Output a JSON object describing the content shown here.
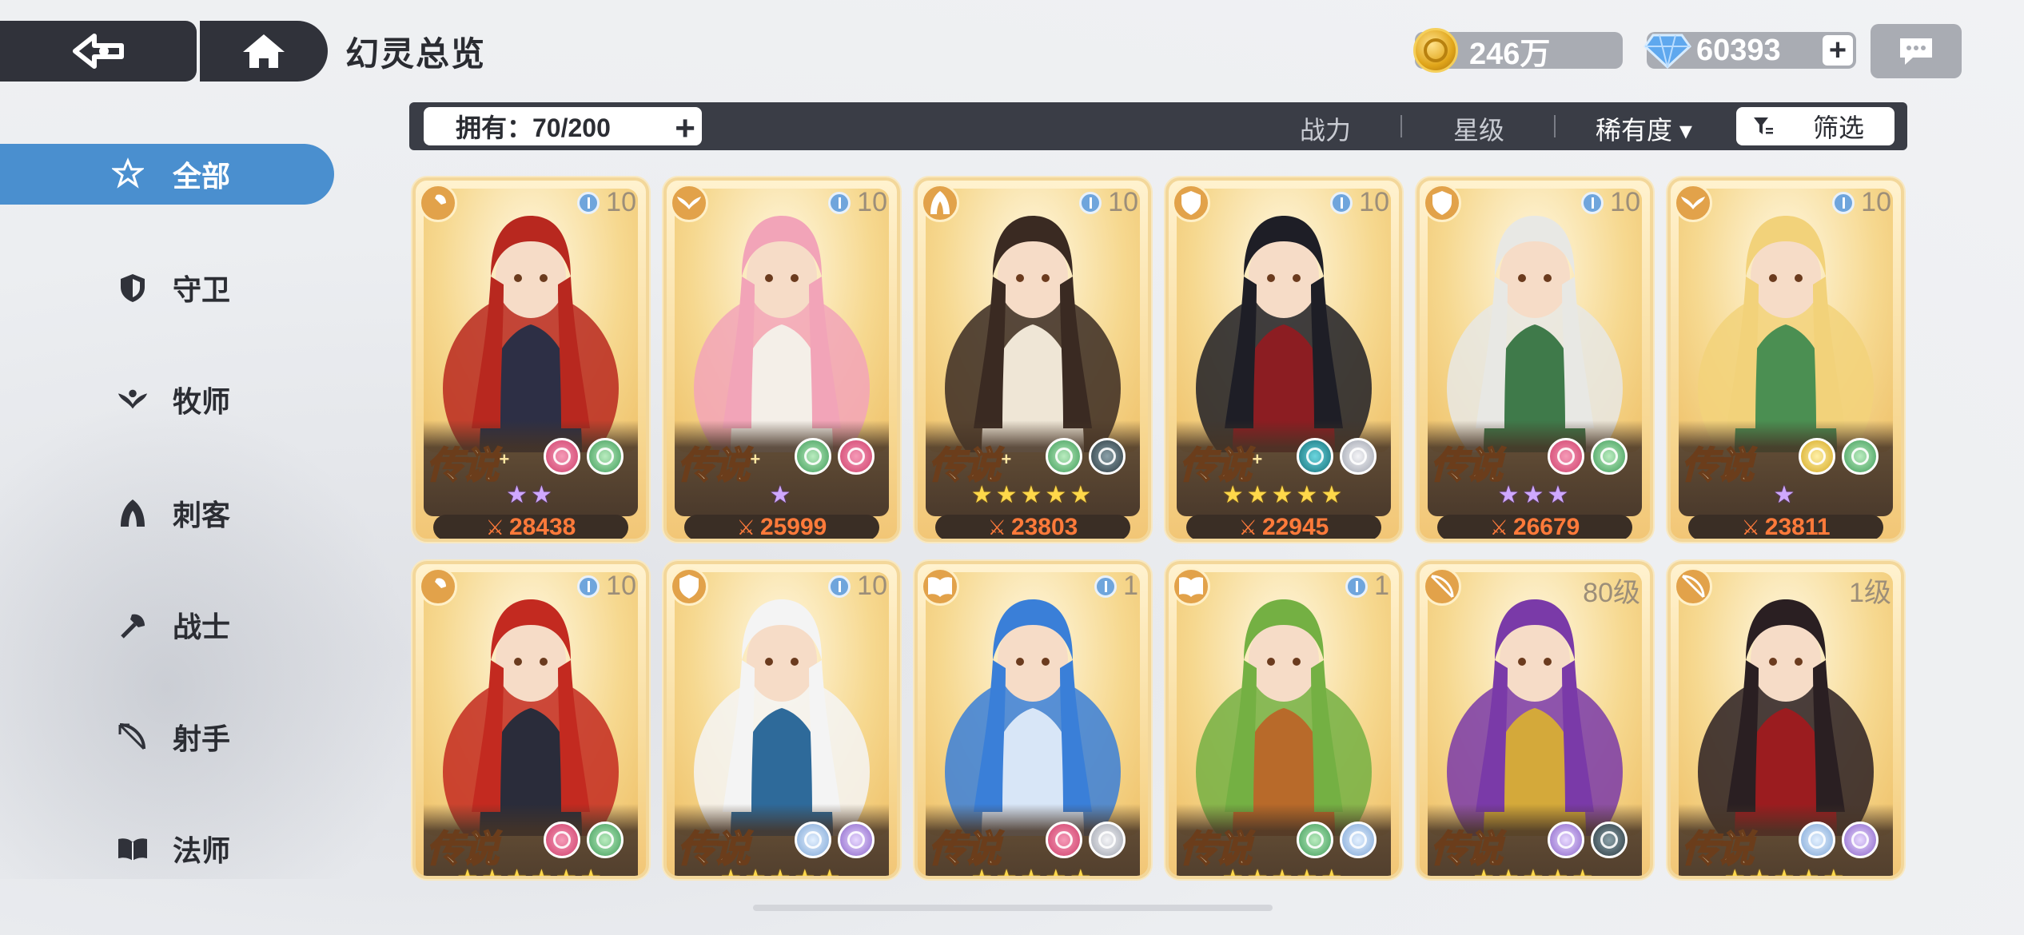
{
  "header": {
    "title": "幻灵总览",
    "gold": "246万",
    "gems": "60393"
  },
  "filter": {
    "owned": "拥有：70/200",
    "sort_power": "战力",
    "sort_star": "星级",
    "sort_rarity": "稀有度 ▾",
    "screen": "筛选"
  },
  "sidebar": {
    "items": [
      {
        "label": "全部"
      },
      {
        "label": "守卫"
      },
      {
        "label": "牧师"
      },
      {
        "label": "刺客"
      },
      {
        "label": "战士"
      },
      {
        "label": "射手"
      },
      {
        "label": "法师"
      }
    ]
  },
  "cards": [
    {
      "level": "10",
      "rarity": "传说",
      "plus": "+",
      "stars": "★★",
      "star_color": "purple",
      "power": "28438"
    },
    {
      "level": "10",
      "rarity": "传说",
      "plus": "+",
      "stars": "★",
      "star_color": "purple",
      "power": "25999"
    },
    {
      "level": "10",
      "rarity": "传说",
      "plus": "+",
      "stars": "★★★★★",
      "star_color": "gold",
      "power": "23803"
    },
    {
      "level": "10",
      "rarity": "传说",
      "plus": "+",
      "stars": "★★★★★",
      "star_color": "gold",
      "power": "22945"
    },
    {
      "level": "10",
      "rarity": "传说",
      "plus": "",
      "stars": "★★★",
      "star_color": "purple",
      "power": "26679"
    },
    {
      "level": "10",
      "rarity": "传说",
      "plus": "",
      "stars": "★",
      "star_color": "purple",
      "power": "23811"
    },
    {
      "level": "10",
      "rarity": "传说",
      "plus": "",
      "stars": "★★★★★★",
      "star_color": "gold",
      "power": ""
    },
    {
      "level": "10",
      "rarity": "传说",
      "plus": "",
      "stars": "★★★★★",
      "star_color": "gold",
      "power": ""
    },
    {
      "level": "1",
      "rarity": "传说",
      "plus": "",
      "stars": "★★★★★",
      "star_color": "gold",
      "power": ""
    },
    {
      "level": "1",
      "rarity": "传说",
      "plus": "",
      "stars": "★★★★★",
      "star_color": "gold",
      "power": ""
    },
    {
      "level": "80级",
      "rarity": "传说",
      "plus": "",
      "stars": "★★★★★",
      "star_color": "gold",
      "power": ""
    },
    {
      "level": "1级",
      "rarity": "传说",
      "plus": "",
      "stars": "★★★★★",
      "star_color": "gold",
      "power": ""
    }
  ]
}
